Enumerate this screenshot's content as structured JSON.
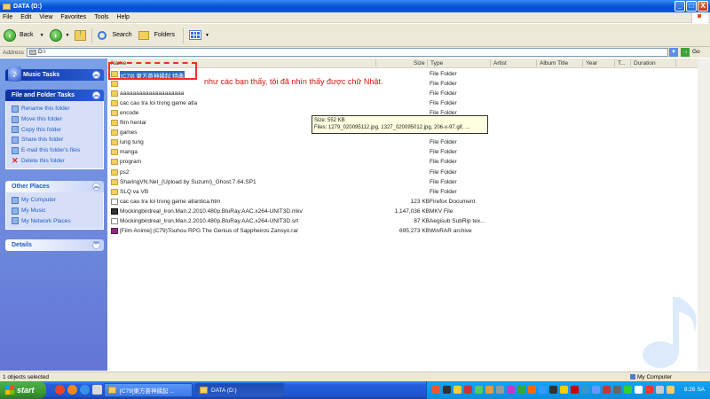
{
  "window": {
    "title": "DATA (D:)",
    "buttons": {
      "minimize": "_",
      "maximize": "□",
      "close": "X"
    }
  },
  "menu": [
    "File",
    "Edit",
    "View",
    "Favorites",
    "Tools",
    "Help"
  ],
  "toolbar": {
    "back": "Back",
    "search": "Search",
    "folders": "Folders"
  },
  "address": {
    "label": "Address",
    "value": "D:\\",
    "go": "Go"
  },
  "columns": {
    "name": "Name",
    "size": "Size",
    "type": "Type",
    "artist": "Artist",
    "album": "Album Title",
    "year": "Year",
    "track": "T...",
    "duration": "Duration"
  },
  "sidebar": {
    "music_tasks": "Music Tasks",
    "file_tasks": {
      "title": "File and Folder Tasks",
      "items": [
        "Rename this folder",
        "Move this folder",
        "Copy this folder",
        "Share this folder",
        "E-mail this folder's files",
        "Delete this folder"
      ]
    },
    "other_places": {
      "title": "Other Places",
      "items": [
        "My Computer",
        "My Music",
        "My Network Places"
      ]
    },
    "details": "Details"
  },
  "files": [
    {
      "name": "[C79] 東方蒼神縁起 特典",
      "size": "",
      "type": "File Folder",
      "icon": "folder"
    },
    {
      "name": "",
      "size": "",
      "type": "File Folder",
      "icon": "folder"
    },
    {
      "name": "aaaaaaaaaaaaaaaaaaaa",
      "size": "",
      "type": "File Folder",
      "icon": "folder"
    },
    {
      "name": "cac cau tra loi trong game atla",
      "size": "",
      "type": "File Folder",
      "icon": "folder"
    },
    {
      "name": "encode",
      "size": "",
      "type": "File Folder",
      "icon": "folder"
    },
    {
      "name": "film hentai",
      "size": "",
      "type": "File Folder",
      "icon": "folder"
    },
    {
      "name": "games",
      "size": "",
      "type": "File Folder",
      "icon": "folder"
    },
    {
      "name": "lung tung",
      "size": "",
      "type": "File Folder",
      "icon": "folder"
    },
    {
      "name": "manga",
      "size": "",
      "type": "File Folder",
      "icon": "folder"
    },
    {
      "name": "program",
      "size": "",
      "type": "File Folder",
      "icon": "folder"
    },
    {
      "name": "ps2",
      "size": "",
      "type": "File Folder",
      "icon": "folder"
    },
    {
      "name": "SharingVN.Net_(Upload by Suzumi)_Ghost.7.64.SP1",
      "size": "",
      "type": "File Folder",
      "icon": "folder"
    },
    {
      "name": "SLQ va VB",
      "size": "",
      "type": "File Folder",
      "icon": "folder"
    },
    {
      "name": "cac cau tra loi trong game atlantica.htm",
      "size": "123 KB",
      "type": "Firefox Document",
      "icon": "doc"
    },
    {
      "name": "Mockingbirdreal_Iron.Man.2.2010.480p.BluRay.AAC.x264-UNIT3D.mkv",
      "size": "1,147,036 KB",
      "type": "MKV File",
      "icon": "mkv"
    },
    {
      "name": "Mockingbirdreal_Iron.Man.2.2010.480p.BluRay.AAC.x264-UNIT3D.srt",
      "size": "87 KB",
      "type": "Aegisub SubRip tex...",
      "icon": "doc"
    },
    {
      "name": "[Film Anime] (C79)Touhou RPG The Genius of Sappheiros Zansyo.rar",
      "size": "695,273 KB",
      "type": "WinRAR archive",
      "icon": "rar"
    }
  ],
  "annotation": "như các bạn thấy, tôi đã nhìn thấy được chữ Nhật.",
  "tooltip": {
    "line1": "Size: 552 KB",
    "line2": "Files: 1279_020095112.jpg, 1327_020095012.jpg, 206-x-97.gif, ..."
  },
  "status": {
    "left": "1 objects selected",
    "right": "My Computer"
  },
  "taskbar": {
    "start": "start",
    "tasks": [
      "[C79]東方蒼神縁起 ...",
      "DATA (D:)"
    ],
    "clock": "8:26 SA"
  },
  "colors": {
    "xp_blue": "#0a5ad8",
    "selection": "#316ac5",
    "annotation_red": "#d4170f"
  }
}
